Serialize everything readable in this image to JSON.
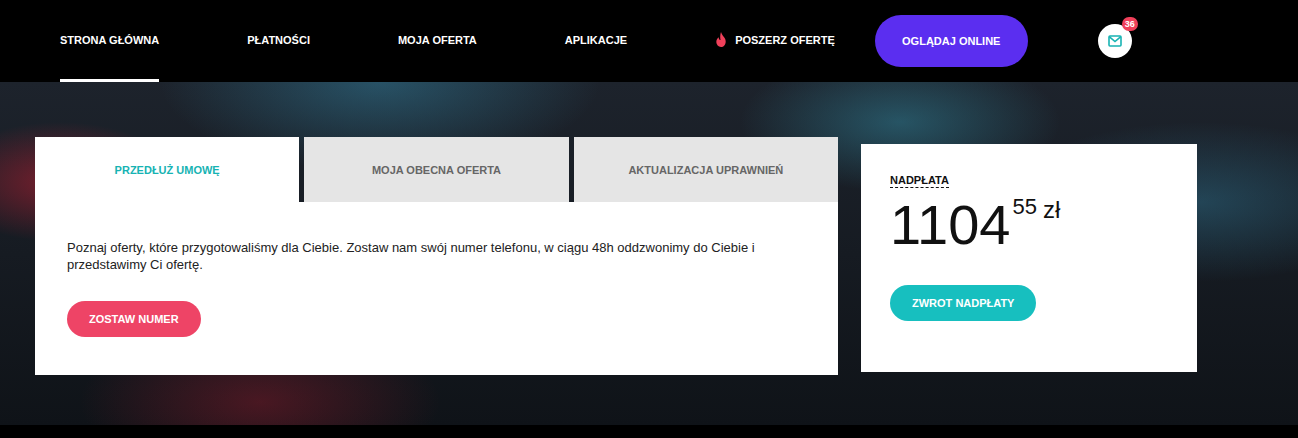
{
  "nav": {
    "items": [
      {
        "label": "STRONA GŁÓWNA",
        "selected": true,
        "hot": false
      },
      {
        "label": "PŁATNOŚCI",
        "selected": false,
        "hot": false
      },
      {
        "label": "MOJA OFERTA",
        "selected": false,
        "hot": false
      },
      {
        "label": "APLIKACJE",
        "selected": false,
        "hot": false
      },
      {
        "label": "POSZERZ OFERTĘ",
        "selected": false,
        "hot": true
      }
    ],
    "watch_button": "OGLĄDAJ ONLINE",
    "messages": {
      "badge": "36"
    }
  },
  "contract_panel": {
    "tabs": [
      {
        "label": "PRZEDŁUŻ UMOWĘ",
        "selected": true
      },
      {
        "label": "MOJA OBECNA OFERTA",
        "selected": false
      },
      {
        "label": "AKTUALIZACJA UPRAWNIEŃ",
        "selected": false
      }
    ],
    "text": "Poznaj oferty, które przygotowaliśmy dla Ciebie. Zostaw nam swój numer telefonu, w ciągu 48h oddzwonimy do Ciebie i przedstawimy Ci ofertę.",
    "button": "ZOSTAW NUMER"
  },
  "balance": {
    "label": "NADPŁATA",
    "amount_main": "1104",
    "amount_fraction": "55",
    "currency": "zł",
    "button": "ZWROT NADPŁATY"
  }
}
